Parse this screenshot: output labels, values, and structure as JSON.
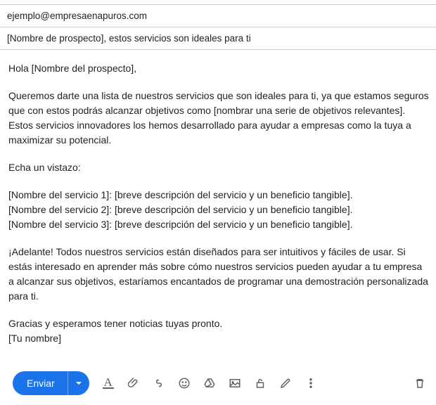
{
  "header": {
    "to": "ejemplo@empresaenapuros.com",
    "subject": "[Nombre de prospecto], estos servicios son ideales para ti"
  },
  "body": {
    "greeting": "Hola [Nombre del prospecto],",
    "intro": "Queremos darte una lista de nuestros servicios que son ideales para ti, ya que estamos seguros que con estos podrás alcanzar objetivos como [nombrar una serie de objetivos relevantes]. Estos servicios innovadores los hemos desarrollado para ayudar a empresas como la tuya a maximizar su potencial.",
    "cta_look": "Echa un vistazo:",
    "service1": "[Nombre del servicio 1]: [breve descripción del servicio y un beneficio tangible].",
    "service2": "[Nombre del servicio 2]: [breve descripción del servicio y un beneficio tangible].",
    "service3": "[Nombre del servicio 3]: [breve descripción del servicio y un beneficio tangible].",
    "closing1": "¡Adelante! Todos nuestros servicios están diseñados para ser intuitivos y fáciles de usar. Si estás interesado en aprender más sobre cómo nuestros servicios pueden ayudar a tu empresa a alcanzar sus objetivos, estaríamos encantados de programar una demostración personalizada para ti.",
    "thanks": "Gracias y esperamos tener noticias tuyas pronto.",
    "signature": "[Tu nombre]"
  },
  "toolbar": {
    "send_label": "Enviar"
  }
}
